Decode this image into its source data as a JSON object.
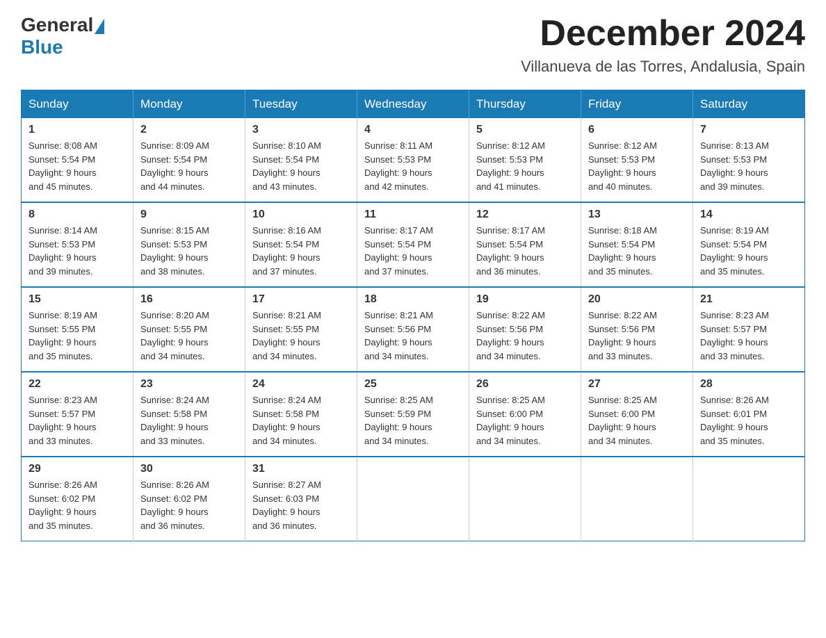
{
  "header": {
    "logo_general": "General",
    "logo_blue": "Blue",
    "month_title": "December 2024",
    "location": "Villanueva de las Torres, Andalusia, Spain"
  },
  "days_of_week": [
    "Sunday",
    "Monday",
    "Tuesday",
    "Wednesday",
    "Thursday",
    "Friday",
    "Saturday"
  ],
  "weeks": [
    [
      {
        "day": "1",
        "sunrise": "8:08 AM",
        "sunset": "5:54 PM",
        "daylight": "9 hours and 45 minutes."
      },
      {
        "day": "2",
        "sunrise": "8:09 AM",
        "sunset": "5:54 PM",
        "daylight": "9 hours and 44 minutes."
      },
      {
        "day": "3",
        "sunrise": "8:10 AM",
        "sunset": "5:54 PM",
        "daylight": "9 hours and 43 minutes."
      },
      {
        "day": "4",
        "sunrise": "8:11 AM",
        "sunset": "5:53 PM",
        "daylight": "9 hours and 42 minutes."
      },
      {
        "day": "5",
        "sunrise": "8:12 AM",
        "sunset": "5:53 PM",
        "daylight": "9 hours and 41 minutes."
      },
      {
        "day": "6",
        "sunrise": "8:12 AM",
        "sunset": "5:53 PM",
        "daylight": "9 hours and 40 minutes."
      },
      {
        "day": "7",
        "sunrise": "8:13 AM",
        "sunset": "5:53 PM",
        "daylight": "9 hours and 39 minutes."
      }
    ],
    [
      {
        "day": "8",
        "sunrise": "8:14 AM",
        "sunset": "5:53 PM",
        "daylight": "9 hours and 39 minutes."
      },
      {
        "day": "9",
        "sunrise": "8:15 AM",
        "sunset": "5:53 PM",
        "daylight": "9 hours and 38 minutes."
      },
      {
        "day": "10",
        "sunrise": "8:16 AM",
        "sunset": "5:54 PM",
        "daylight": "9 hours and 37 minutes."
      },
      {
        "day": "11",
        "sunrise": "8:17 AM",
        "sunset": "5:54 PM",
        "daylight": "9 hours and 37 minutes."
      },
      {
        "day": "12",
        "sunrise": "8:17 AM",
        "sunset": "5:54 PM",
        "daylight": "9 hours and 36 minutes."
      },
      {
        "day": "13",
        "sunrise": "8:18 AM",
        "sunset": "5:54 PM",
        "daylight": "9 hours and 35 minutes."
      },
      {
        "day": "14",
        "sunrise": "8:19 AM",
        "sunset": "5:54 PM",
        "daylight": "9 hours and 35 minutes."
      }
    ],
    [
      {
        "day": "15",
        "sunrise": "8:19 AM",
        "sunset": "5:55 PM",
        "daylight": "9 hours and 35 minutes."
      },
      {
        "day": "16",
        "sunrise": "8:20 AM",
        "sunset": "5:55 PM",
        "daylight": "9 hours and 34 minutes."
      },
      {
        "day": "17",
        "sunrise": "8:21 AM",
        "sunset": "5:55 PM",
        "daylight": "9 hours and 34 minutes."
      },
      {
        "day": "18",
        "sunrise": "8:21 AM",
        "sunset": "5:56 PM",
        "daylight": "9 hours and 34 minutes."
      },
      {
        "day": "19",
        "sunrise": "8:22 AM",
        "sunset": "5:56 PM",
        "daylight": "9 hours and 34 minutes."
      },
      {
        "day": "20",
        "sunrise": "8:22 AM",
        "sunset": "5:56 PM",
        "daylight": "9 hours and 33 minutes."
      },
      {
        "day": "21",
        "sunrise": "8:23 AM",
        "sunset": "5:57 PM",
        "daylight": "9 hours and 33 minutes."
      }
    ],
    [
      {
        "day": "22",
        "sunrise": "8:23 AM",
        "sunset": "5:57 PM",
        "daylight": "9 hours and 33 minutes."
      },
      {
        "day": "23",
        "sunrise": "8:24 AM",
        "sunset": "5:58 PM",
        "daylight": "9 hours and 33 minutes."
      },
      {
        "day": "24",
        "sunrise": "8:24 AM",
        "sunset": "5:58 PM",
        "daylight": "9 hours and 34 minutes."
      },
      {
        "day": "25",
        "sunrise": "8:25 AM",
        "sunset": "5:59 PM",
        "daylight": "9 hours and 34 minutes."
      },
      {
        "day": "26",
        "sunrise": "8:25 AM",
        "sunset": "6:00 PM",
        "daylight": "9 hours and 34 minutes."
      },
      {
        "day": "27",
        "sunrise": "8:25 AM",
        "sunset": "6:00 PM",
        "daylight": "9 hours and 34 minutes."
      },
      {
        "day": "28",
        "sunrise": "8:26 AM",
        "sunset": "6:01 PM",
        "daylight": "9 hours and 35 minutes."
      }
    ],
    [
      {
        "day": "29",
        "sunrise": "8:26 AM",
        "sunset": "6:02 PM",
        "daylight": "9 hours and 35 minutes."
      },
      {
        "day": "30",
        "sunrise": "8:26 AM",
        "sunset": "6:02 PM",
        "daylight": "9 hours and 36 minutes."
      },
      {
        "day": "31",
        "sunrise": "8:27 AM",
        "sunset": "6:03 PM",
        "daylight": "9 hours and 36 minutes."
      },
      null,
      null,
      null,
      null
    ]
  ],
  "labels": {
    "sunrise": "Sunrise:",
    "sunset": "Sunset:",
    "daylight": "Daylight:"
  }
}
